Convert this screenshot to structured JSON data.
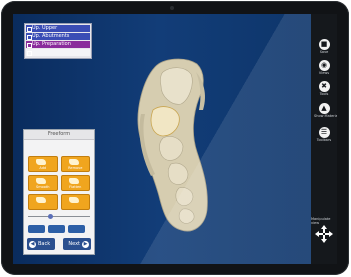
{
  "layers": {
    "rows": [
      {
        "label": "Up. Upper",
        "color": "#3a4db5"
      },
      {
        "label": "Up. Abutments",
        "color": "#3a4db5"
      },
      {
        "label": "Up. Preparation",
        "color": "#8a2c9c"
      },
      {
        "label": "",
        "color": "#f4f4f7"
      }
    ]
  },
  "dialog": {
    "title": "Freeform",
    "tools": [
      {
        "label": "Add",
        "icon": "add-material-icon"
      },
      {
        "label": "Remove",
        "icon": "remove-material-icon"
      },
      {
        "label": "Smooth",
        "icon": "smooth-icon"
      },
      {
        "label": "Flatten",
        "icon": "flatten-icon"
      },
      {
        "label": "",
        "icon": "tool-icon"
      },
      {
        "label": "",
        "icon": "tool-icon"
      }
    ],
    "back_label": "Back",
    "next_label": "Next"
  },
  "toolbar": {
    "items": [
      {
        "label": "Save",
        "icon": "save-icon"
      },
      {
        "label": "Views",
        "icon": "views-icon"
      },
      {
        "label": "Tools",
        "icon": "tools-icon"
      },
      {
        "label": "Show Materials",
        "icon": "materials-icon"
      },
      {
        "label": "Toolbars",
        "icon": "toolbars-icon"
      }
    ],
    "move_label": "Manipulate view",
    "move_icon": "move-arrows-icon"
  },
  "colors": {
    "screen_background": "#0f3870",
    "tool_accent": "#f0a51e",
    "nav_button": "#2a4f8f",
    "toolbar_background": "#15181c",
    "dental_model": "#d8cfb2"
  }
}
